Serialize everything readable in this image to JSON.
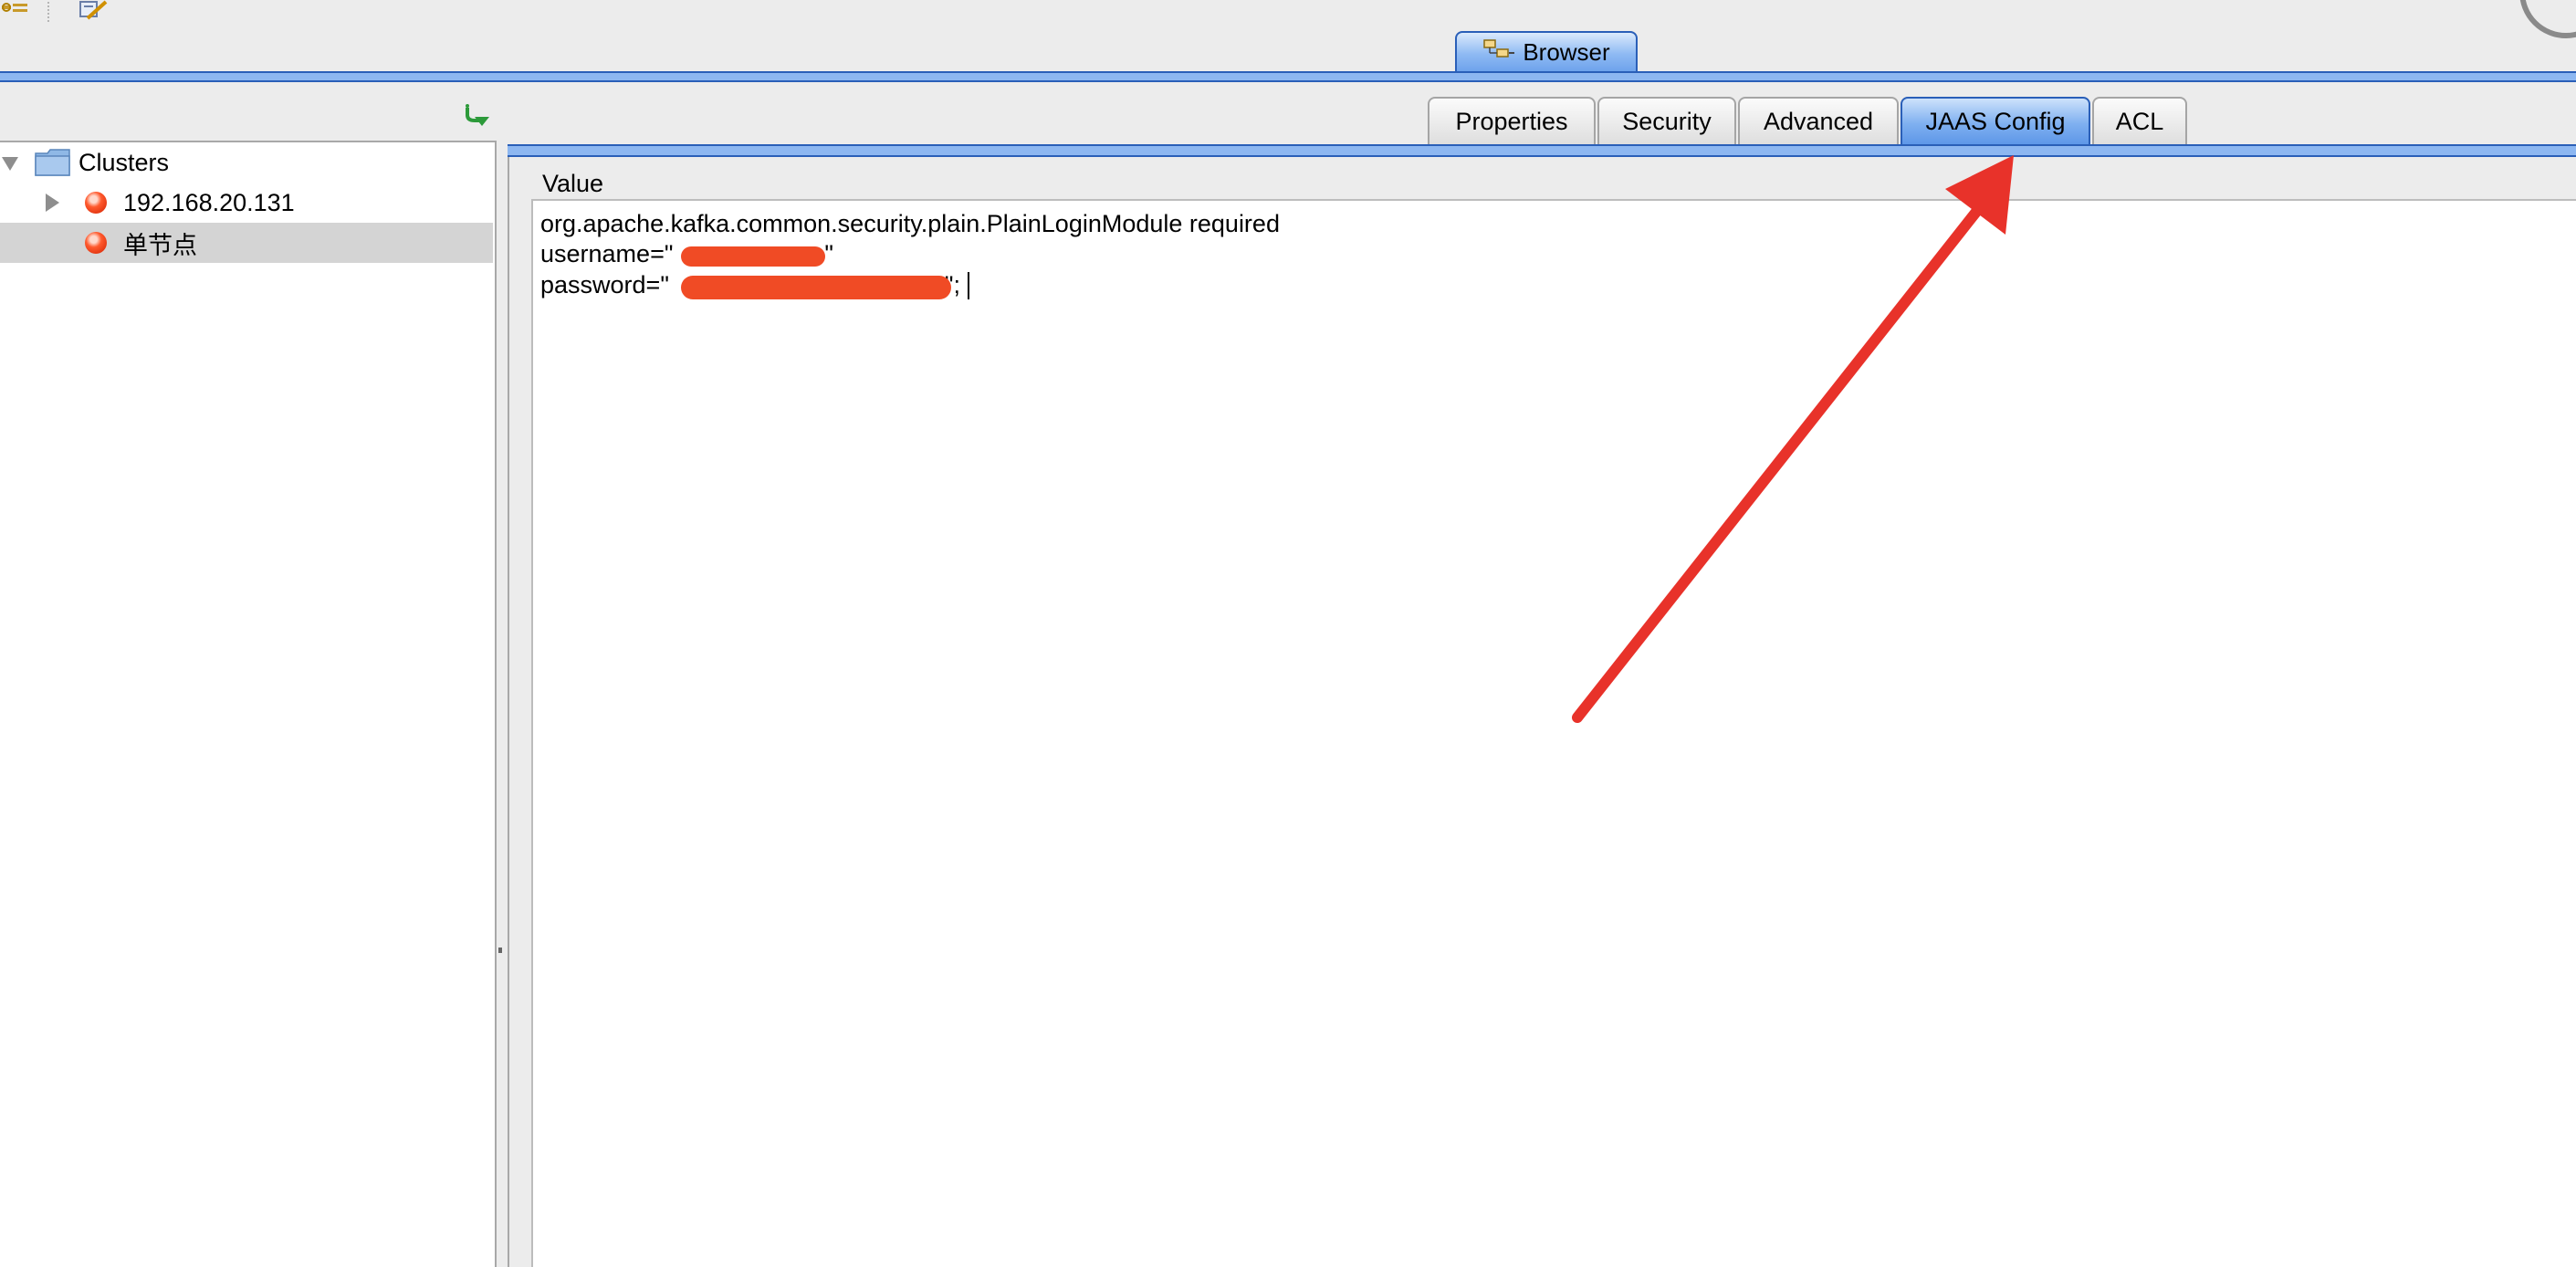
{
  "toolbar": {
    "icons": [
      "config-icon",
      "edit-icon"
    ]
  },
  "perspective": {
    "tab_label": "Browser",
    "tab_icon": "browser-tree-icon"
  },
  "tree": {
    "refresh_icon": "refresh-arrow-icon",
    "root": {
      "label": "Clusters",
      "icon": "folder-icon",
      "expanded": true
    },
    "items": [
      {
        "label": "192.168.20.131",
        "icon": "red-node-icon",
        "expandable": true,
        "selected": false
      },
      {
        "label": "单节点",
        "icon": "red-node-icon",
        "expandable": false,
        "selected": true
      }
    ]
  },
  "tabs": [
    {
      "label": "Properties",
      "active": false
    },
    {
      "label": "Security",
      "active": false
    },
    {
      "label": "Advanced",
      "active": false
    },
    {
      "label": "JAAS Config",
      "active": true
    },
    {
      "label": "ACL",
      "active": false
    }
  ],
  "editor": {
    "column_header": "Value",
    "line1": "org.apache.kafka.common.security.plain.PlainLoginModule required",
    "line2_prefix": "username=\"",
    "line2_suffix": "\"",
    "line3_prefix": "password=\"",
    "line3_suffix": "\";"
  },
  "colors": {
    "active_tab": "#7fb0f0",
    "annotation_arrow": "#e8322a",
    "redaction": "#f04b25",
    "status_node": "#ff5a2e"
  }
}
